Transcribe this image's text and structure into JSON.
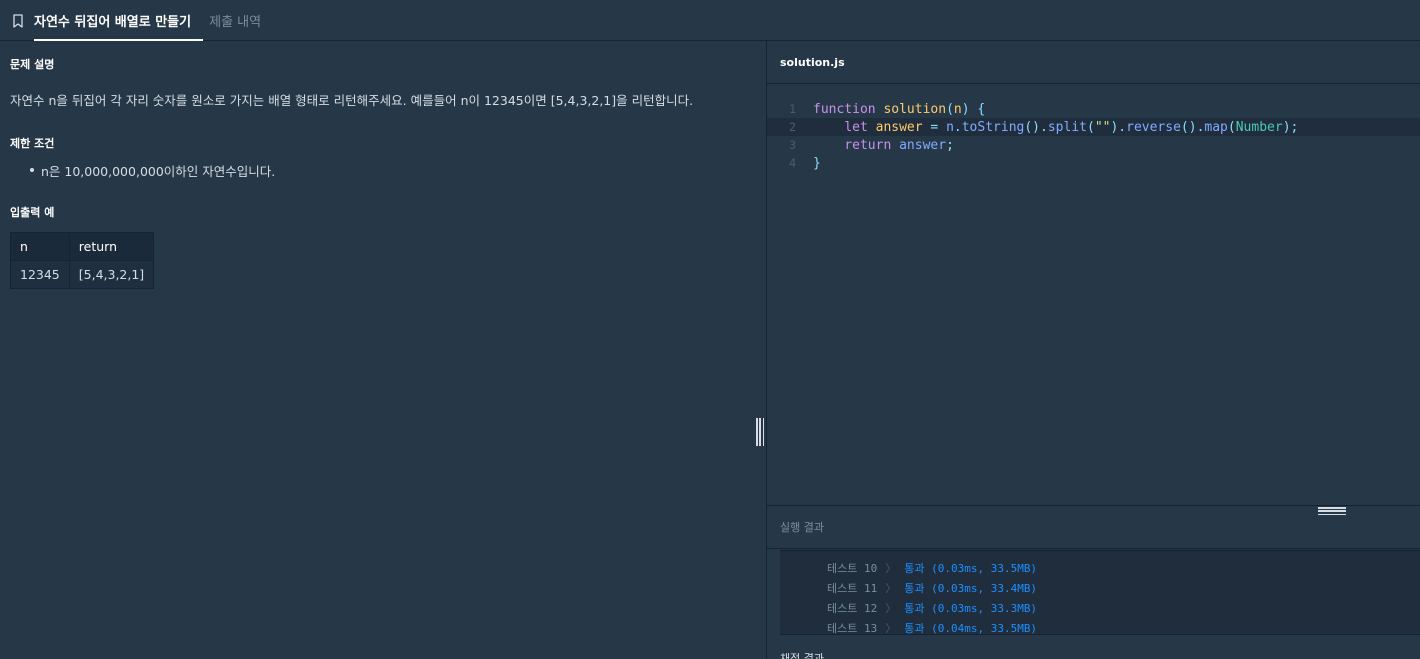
{
  "tabs": {
    "active_label": "자연수 뒤집어 배열로 만들기",
    "inactive_label": "제출 내역"
  },
  "problem": {
    "description_title": "문제 설명",
    "description": "자연수 n을 뒤집어 각 자리 숫자를 원소로 가지는 배열 형태로 리턴해주세요. 예를들어 n이 12345이면 [5,4,3,2,1]을 리턴합니다.",
    "constraints_title": "제한 조건",
    "constraints": [
      "n은 10,000,000,000이하인 자연수입니다."
    ],
    "io_title": "입출력 예",
    "io_headers": [
      "n",
      "return"
    ],
    "io_rows": [
      [
        "12345",
        "[5,4,3,2,1]"
      ]
    ]
  },
  "editor": {
    "filename": "solution.js",
    "line_numbers": [
      "1",
      "2",
      "3",
      "4"
    ]
  },
  "results": {
    "title": "실행 결과",
    "rows": [
      {
        "label": "테스트 10",
        "status": "통과 (0.03ms, 33.5MB)"
      },
      {
        "label": "테스트 11",
        "status": "통과 (0.03ms, 33.4MB)"
      },
      {
        "label": "테스트 12",
        "status": "통과 (0.03ms, 33.3MB)"
      },
      {
        "label": "테스트 13",
        "status": "통과 (0.04ms, 33.5MB)"
      }
    ],
    "next_section_title": "채점 결과"
  }
}
